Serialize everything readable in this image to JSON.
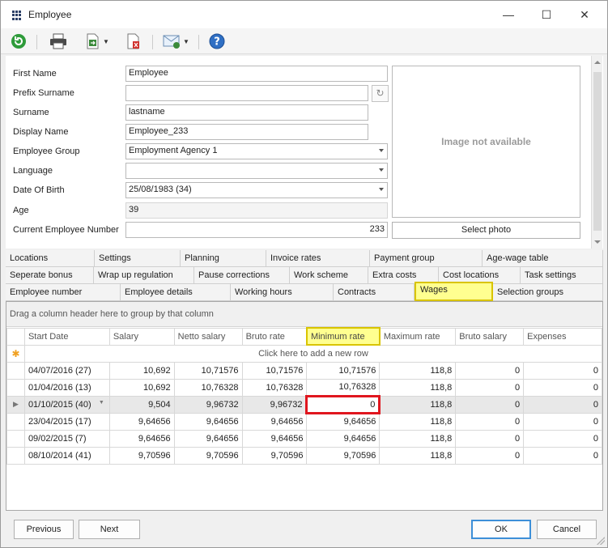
{
  "window": {
    "title": "Employee",
    "minimize_glyph": "—",
    "maximize_glyph": "☐",
    "close_glyph": "✕"
  },
  "toolbar": {
    "icons": [
      "refresh-icon",
      "print-icon",
      "export-icon",
      "delete-document-icon",
      "email-icon",
      "help-icon"
    ]
  },
  "form": {
    "fields": {
      "first_name": {
        "label": "First Name",
        "value": "Employee"
      },
      "prefix_surname": {
        "label": "Prefix Surname",
        "value": ""
      },
      "surname": {
        "label": "Surname",
        "value": "lastname"
      },
      "display_name": {
        "label": "Display Name",
        "value": "Employee_233"
      },
      "employee_group": {
        "label": "Employee Group",
        "value": "Employment Agency 1"
      },
      "language": {
        "label": "Language",
        "value": ""
      },
      "date_of_birth": {
        "label": "Date Of Birth",
        "value": "25/08/1983 (34)"
      },
      "age": {
        "label": "Age",
        "value": "39"
      },
      "current_employee_number": {
        "label": "Current Employee Number",
        "value": "233"
      }
    },
    "photo_placeholder": "Image not available",
    "select_photo_label": "Select photo"
  },
  "tabs": {
    "row1": [
      "Locations",
      "Settings",
      "Planning",
      "Invoice rates",
      "Payment group",
      "Age-wage table"
    ],
    "row2": [
      "Seperate bonus",
      "Wrap up regulation",
      "Pause corrections",
      "Work scheme",
      "Extra costs",
      "Cost locations",
      "Task settings"
    ],
    "row3": [
      "Employee number",
      "Employee details",
      "Working hours",
      "Contracts",
      "Wages",
      "Selection groups"
    ],
    "active": "Wages"
  },
  "grid": {
    "group_hint": "Drag a column header here to group by that column",
    "columns": [
      "Start Date",
      "Salary",
      "Netto salary",
      "Bruto rate",
      "Minimum rate",
      "Maximum rate",
      "Bruto salary",
      "Expenses"
    ],
    "new_row_text": "Click here to add a new row",
    "rows": [
      [
        "04/07/2016 (27)",
        "10,692",
        "10,71576",
        "10,71576",
        "10,71576",
        "118,8",
        "0",
        "0"
      ],
      [
        "01/04/2016 (13)",
        "10,692",
        "10,76328",
        "10,76328",
        "10,76328",
        "118,8",
        "0",
        "0"
      ],
      [
        "01/10/2015 (40)",
        "9,504",
        "9,96732",
        "9,96732",
        "0",
        "118,8",
        "0",
        "0"
      ],
      [
        "23/04/2015 (17)",
        "9,64656",
        "9,64656",
        "9,64656",
        "9,64656",
        "118,8",
        "0",
        "0"
      ],
      [
        "09/02/2015 (7)",
        "9,64656",
        "9,64656",
        "9,64656",
        "9,64656",
        "118,8",
        "0",
        "0"
      ],
      [
        "08/10/2014 (41)",
        "9,70596",
        "9,70596",
        "9,70596",
        "9,70596",
        "118,8",
        "0",
        "0"
      ]
    ],
    "focused_row_index": 2
  },
  "footer": {
    "previous": "Previous",
    "next": "Next",
    "ok": "OK",
    "cancel": "Cancel"
  }
}
